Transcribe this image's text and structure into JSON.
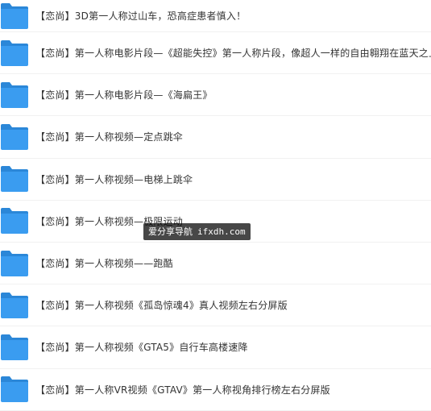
{
  "colors": {
    "folder": "#3a9cf0",
    "folder_dark": "#2b87d8",
    "text": "#333333",
    "watermark_bg": "#1f1f1f"
  },
  "files": [
    {
      "name": "【恋尚】3D第一人称过山车，恐高症患者慎入！",
      "icon": "folder-icon"
    },
    {
      "name": "【恋尚】第一人称电影片段—《超能失控》第一人称片段，像超人一样的自由翱翔在蓝天之上",
      "icon": "folder-icon"
    },
    {
      "name": "【恋尚】第一人称电影片段—《海扁王》",
      "icon": "folder-icon"
    },
    {
      "name": "【恋尚】第一人称视频—定点跳伞",
      "icon": "folder-icon"
    },
    {
      "name": "【恋尚】第一人称视频—电梯上跳伞",
      "icon": "folder-icon"
    },
    {
      "name": "【恋尚】第一人称视频—极限运动",
      "icon": "folder-icon"
    },
    {
      "name": "【恋尚】第一人称视频——跑酷",
      "icon": "folder-icon"
    },
    {
      "name": "【恋尚】第一人称视频《孤岛惊魂4》真人视频左右分屏版",
      "icon": "folder-icon"
    },
    {
      "name": "【恋尚】第一人称视频《GTA5》自行车高楼速降",
      "icon": "folder-icon"
    },
    {
      "name": "【恋尚】第一人称VR视频《GTAV》第一人称视角排行榜左右分屏版",
      "icon": "folder-icon"
    }
  ],
  "watermark": {
    "label": "爱分享导航",
    "url": "ifxdh.com"
  }
}
